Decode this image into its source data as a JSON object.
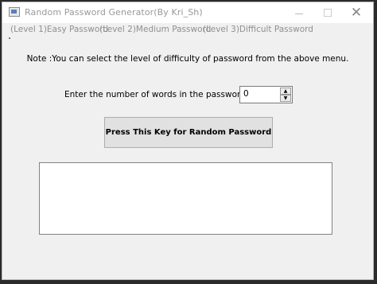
{
  "window": {
    "title": "Random Password Generator(By Kri_Sh)",
    "close_glyph": "✕"
  },
  "menu": {
    "items": [
      "(Level 1)Easy Password",
      "(Level 2)Medium Password",
      "(Level 3)Difficult Password"
    ]
  },
  "note": "Note :You can select the level of difficulty of password from the above menu.",
  "words": {
    "label": "Enter the number of words in the password :",
    "value": "0",
    "up_glyph": "▲",
    "down_glyph": "▼"
  },
  "generate_button": "Press This Key for Random Password",
  "output": {
    "text": ""
  }
}
